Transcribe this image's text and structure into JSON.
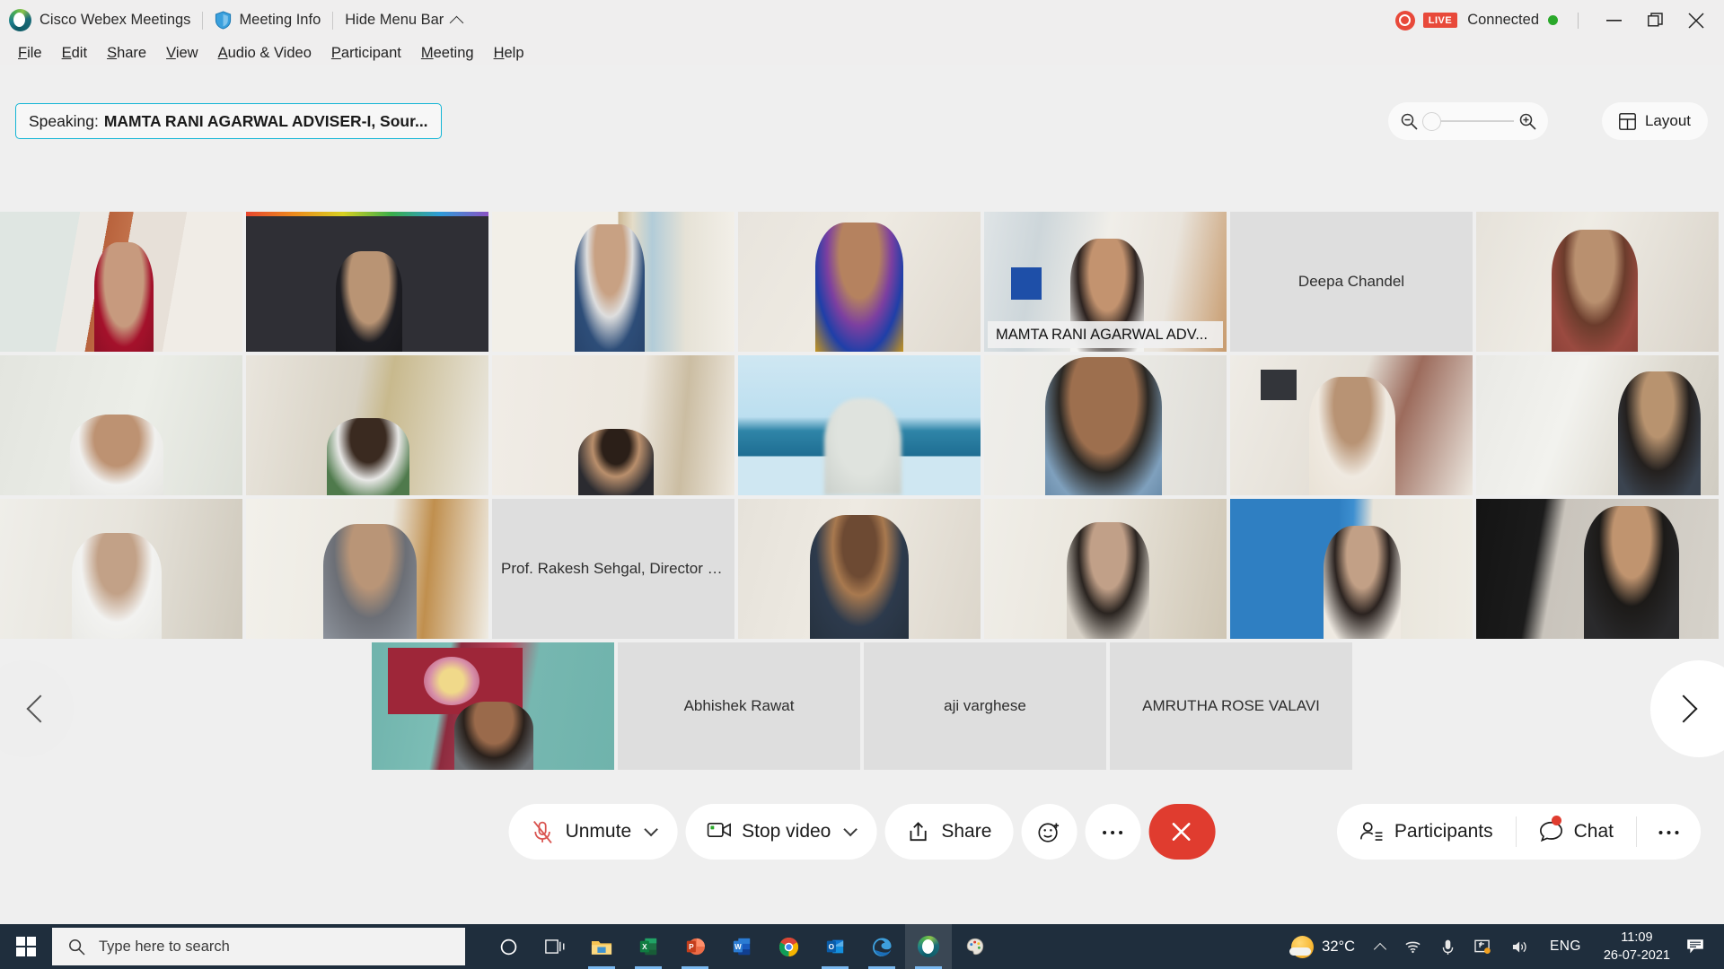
{
  "titlebar": {
    "app_name": "Cisco Webex Meetings",
    "meeting_info_label": "Meeting Info",
    "hide_menu_label": "Hide Menu Bar",
    "live_badge": "LIVE",
    "connection_status": "Connected",
    "recording_icon": "record-icon",
    "shield_icon": "shield-icon",
    "chevron_up_icon": "chevron-up-icon",
    "minimize_icon": "minimize-icon",
    "restore_icon": "restore-icon",
    "close_icon": "close-icon",
    "accent_live": "#e8493a",
    "accent_connected": "#2aa82a"
  },
  "menubar": {
    "items": [
      {
        "label": "File",
        "accel": "F"
      },
      {
        "label": "Edit",
        "accel": "E"
      },
      {
        "label": "Share",
        "accel": "S"
      },
      {
        "label": "View",
        "accel": "V"
      },
      {
        "label": "Audio & Video",
        "accel": "A"
      },
      {
        "label": "Participant",
        "accel": "P"
      },
      {
        "label": "Meeting",
        "accel": "M"
      },
      {
        "label": "Help",
        "accel": "H"
      }
    ]
  },
  "toolbar": {
    "speaking_label": "Speaking:",
    "speaking_name": "MAMTA RANI AGARWAL ADVISER-I, Sour...",
    "speaking_border_color": "#12b5d5",
    "zoom_out_icon": "zoom-out-icon",
    "zoom_in_icon": "zoom-in-icon",
    "zoom_level_percent": 0,
    "layout_label": "Layout",
    "layout_icon": "grid-layout-icon"
  },
  "stage": {
    "active_speaker_name": "MAMTA RANI AGARWAL ADV...",
    "active_border_color": "#18b4de",
    "prev_icon": "chevron-left-icon",
    "next_icon": "chevron-right-icon",
    "rows": [
      {
        "tiles": [
          {
            "kind": "video",
            "name": "",
            "active": false
          },
          {
            "kind": "video",
            "name": "",
            "active": false
          },
          {
            "kind": "video",
            "name": "",
            "active": false
          },
          {
            "kind": "video",
            "name": "",
            "active": false
          },
          {
            "kind": "video",
            "name": "MAMTA RANI AGARWAL ADV...",
            "active": true
          },
          {
            "kind": "placeholder",
            "name": "Deepa Chandel",
            "active": false
          },
          {
            "kind": "video",
            "name": "",
            "active": false
          }
        ]
      },
      {
        "tiles": [
          {
            "kind": "video",
            "name": "",
            "active": false
          },
          {
            "kind": "video",
            "name": "",
            "active": false
          },
          {
            "kind": "video",
            "name": "",
            "active": false
          },
          {
            "kind": "video",
            "name": "",
            "active": false
          },
          {
            "kind": "video",
            "name": "",
            "active": false
          },
          {
            "kind": "video",
            "name": "",
            "active": false
          },
          {
            "kind": "video",
            "name": "",
            "active": false
          }
        ]
      },
      {
        "tiles": [
          {
            "kind": "video",
            "name": "",
            "active": false
          },
          {
            "kind": "video",
            "name": "",
            "active": false
          },
          {
            "kind": "placeholder",
            "name": "Prof. Rakesh Sehgal, Director NI...",
            "active": false
          },
          {
            "kind": "video",
            "name": "",
            "active": false
          },
          {
            "kind": "video",
            "name": "",
            "active": false
          },
          {
            "kind": "video",
            "name": "",
            "active": false
          },
          {
            "kind": "video",
            "name": "",
            "active": false
          }
        ]
      },
      {
        "tiles": [
          {
            "kind": "video",
            "name": "",
            "active": false
          },
          {
            "kind": "placeholder",
            "name": "Abhishek Rawat",
            "active": false
          },
          {
            "kind": "placeholder",
            "name": "aji varghese",
            "active": false
          },
          {
            "kind": "placeholder",
            "name": "AMRUTHA ROSE VALAVI",
            "active": false
          }
        ]
      }
    ]
  },
  "controls": {
    "mute_label": "Unmute",
    "mute_icon": "microphone-muted-icon",
    "video_label": "Stop video",
    "video_icon": "camera-icon",
    "share_label": "Share",
    "share_icon": "share-upload-icon",
    "reaction_icon": "reaction-smiley-icon",
    "more_icon": "more-dots-icon",
    "leave_icon": "close-x-icon",
    "leave_color": "#e03c2f",
    "participants_label": "Participants",
    "participants_icon": "participants-icon",
    "chat_label": "Chat",
    "chat_icon": "chat-bubble-icon",
    "chat_has_notification": true,
    "right_more_icon": "more-dots-icon"
  },
  "taskbar": {
    "start_icon": "windows-start-icon",
    "search_placeholder": "Type here to search",
    "search_icon": "search-icon",
    "apps": [
      {
        "name": "cortana-icon",
        "running": false,
        "active": false
      },
      {
        "name": "task-view-icon",
        "running": false,
        "active": false
      },
      {
        "name": "file-explorer-icon",
        "running": true,
        "active": false
      },
      {
        "name": "excel-icon",
        "running": true,
        "active": false
      },
      {
        "name": "powerpoint-icon",
        "running": true,
        "active": false
      },
      {
        "name": "word-icon",
        "running": false,
        "active": false
      },
      {
        "name": "chrome-icon",
        "running": false,
        "active": false
      },
      {
        "name": "outlook-icon",
        "running": true,
        "active": false
      },
      {
        "name": "edge-icon",
        "running": true,
        "active": false
      },
      {
        "name": "webex-icon",
        "running": true,
        "active": true
      },
      {
        "name": "paint-icon",
        "running": false,
        "active": false
      }
    ],
    "weather_temp": "32°C",
    "weather_icon": "sun-cloud-icon",
    "tray_chevron_icon": "chevron-up-icon",
    "wifi_icon": "wifi-icon",
    "mic_icon": "microphone-icon",
    "screenshare_icon": "screen-share-icon",
    "volume_icon": "volume-icon",
    "language": "ENG",
    "time": "11:09",
    "date": "26-07-2021",
    "notification_icon": "notification-icon"
  }
}
